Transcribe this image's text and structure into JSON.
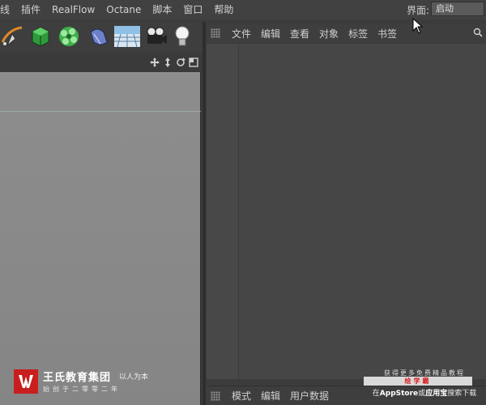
{
  "menubar": {
    "items": [
      "线",
      "插件",
      "RealFlow",
      "Octane",
      "脚本",
      "窗口",
      "帮助"
    ],
    "layout_label": "界面:",
    "layout_value": "启动"
  },
  "toolbar": {
    "icons": [
      "spline-pen-icon",
      "cube-primitive-icon",
      "subdivision-surface-icon",
      "deformer-icon",
      "floor-environment-icon",
      "camera-icon",
      "light-icon"
    ]
  },
  "viewport": {
    "header_icons": [
      "move-view-icon",
      "zoom-view-icon",
      "rotate-view-icon",
      "switch-view-icon"
    ]
  },
  "object_manager": {
    "menu": [
      "文件",
      "编辑",
      "查看",
      "对象",
      "标签",
      "书签"
    ]
  },
  "attribute_manager": {
    "menu": [
      "模式",
      "编辑",
      "用户数据"
    ]
  },
  "watermark": {
    "title": "王氏教育集团",
    "slogan": "以人为本",
    "subtitle": "始创于二零零二年"
  },
  "promo": {
    "top": "获得更多免费精品教程",
    "bar": "绘学霸",
    "bottom_prefix": "在",
    "bottom_store": "AppStore",
    "bottom_middle": "或",
    "bottom_app": "应用宝",
    "bottom_suffix": "搜索下载"
  },
  "colors": {
    "background": "#3c3c3c",
    "viewport": "#8a8a8a",
    "panel": "#464646",
    "brand_red": "#c81e1e"
  }
}
